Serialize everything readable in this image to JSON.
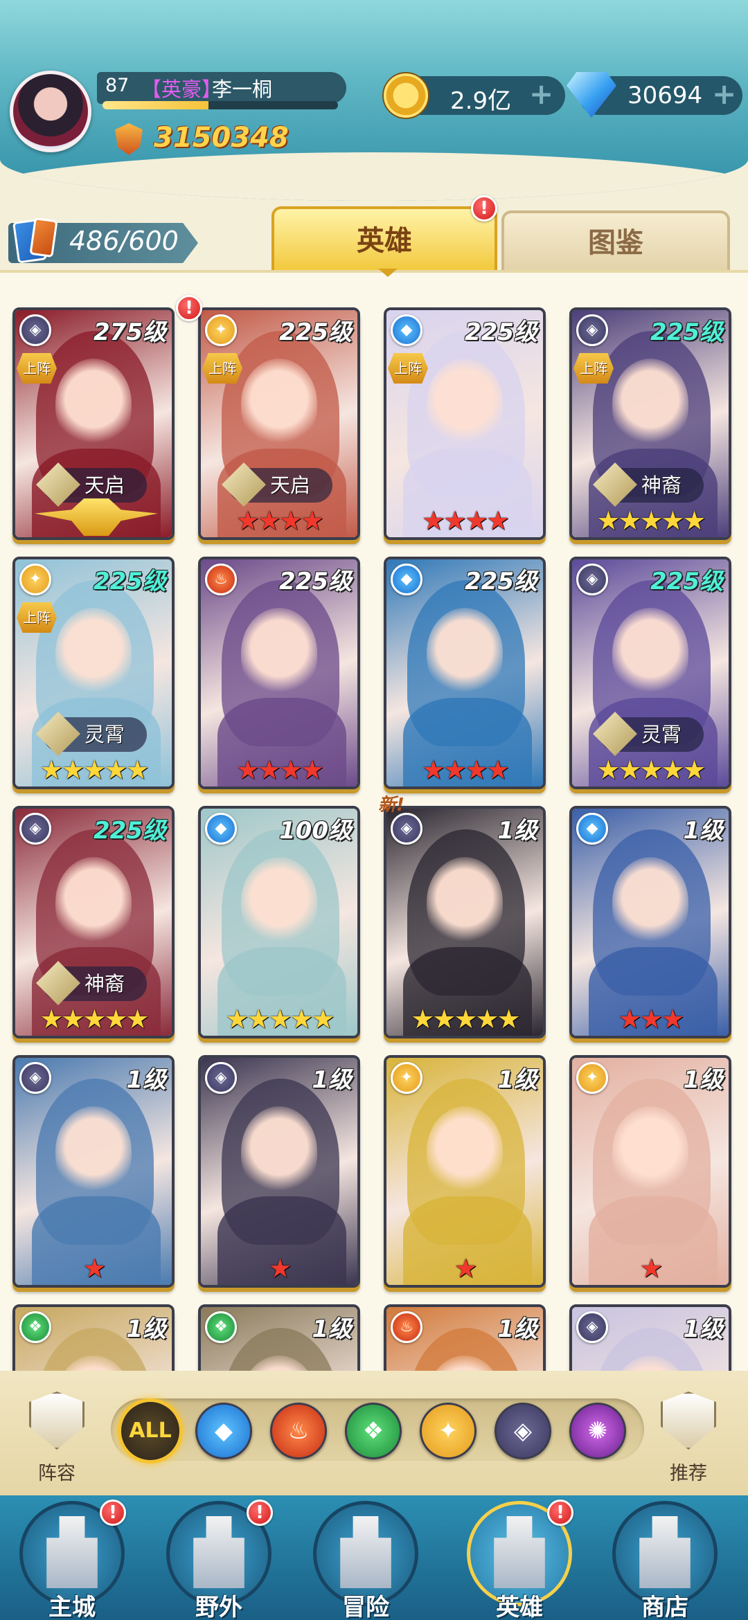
{
  "player": {
    "level": "87",
    "title": "【英豪】",
    "name": "李一桐",
    "exp_progress": 0.45,
    "power": "3150348"
  },
  "currency": {
    "gold": "2.9亿",
    "gems": "30694",
    "plus": "+"
  },
  "roster": {
    "count": "486/600",
    "tabs": [
      {
        "label": "英雄",
        "active": true,
        "alert": "!"
      },
      {
        "label": "图鉴",
        "active": false
      }
    ]
  },
  "heroes": [
    {
      "level": "275级",
      "element": "dark",
      "deployed": "上阵",
      "rank": "天启",
      "stars": "crown",
      "alert": "!",
      "color": "#8a1b28"
    },
    {
      "level": "225级",
      "element": "light",
      "deployed": "上阵",
      "rank": "天启",
      "stars": "★★★★",
      "star_color": "red",
      "color": "#c25a48"
    },
    {
      "level": "225级",
      "element": "water",
      "deployed": "上阵",
      "rank": "",
      "stars": "★★★★",
      "star_color": "red",
      "color": "#d8d3ef"
    },
    {
      "level": "225级",
      "element": "dark",
      "deployed": "上阵",
      "rank": "神裔",
      "stars": "★★★★★",
      "star_color": "gold",
      "level_cyan": true,
      "color": "#4b3e7a"
    },
    {
      "level": "225级",
      "element": "light",
      "deployed": "上阵",
      "rank": "灵霄",
      "stars": "★★★★★",
      "star_color": "gold",
      "level_cyan": true,
      "color": "#8fc2d8"
    },
    {
      "level": "225级",
      "element": "fire",
      "deployed": "",
      "rank": "",
      "stars": "★★★★",
      "star_color": "red",
      "color": "#6b4a8a"
    },
    {
      "level": "225级",
      "element": "water",
      "deployed": "",
      "rank": "",
      "stars": "★★★★",
      "star_color": "red",
      "color": "#2f78b8"
    },
    {
      "level": "225级",
      "element": "dark",
      "deployed": "",
      "rank": "灵霄",
      "stars": "★★★★★",
      "star_color": "gold",
      "level_cyan": true,
      "color": "#5b4a9a"
    },
    {
      "level": "225级",
      "element": "dark",
      "deployed": "",
      "rank": "神裔",
      "stars": "★★★★★",
      "star_color": "gold",
      "level_cyan": true,
      "color": "#8a2a3a"
    },
    {
      "level": "100级",
      "element": "water",
      "deployed": "",
      "rank": "",
      "stars": "★★★★★",
      "star_color": "gold",
      "color": "#9ec7c9"
    },
    {
      "level": "1级",
      "element": "dark",
      "deployed": "",
      "rank": "",
      "stars": "★★★★★",
      "star_color": "gold",
      "new": "新!",
      "color": "#2a2630"
    },
    {
      "level": "1级",
      "element": "water",
      "deployed": "",
      "rank": "",
      "stars": "★★★",
      "star_color": "red",
      "color": "#3a5fa8"
    },
    {
      "level": "1级",
      "element": "dark",
      "deployed": "",
      "rank": "",
      "stars": "★",
      "star_color": "red",
      "color": "#4a7ab0"
    },
    {
      "level": "1级",
      "element": "dark",
      "deployed": "",
      "rank": "",
      "stars": "★",
      "star_color": "red",
      "color": "#3b3550"
    },
    {
      "level": "1级",
      "element": "light",
      "deployed": "",
      "rank": "",
      "stars": "★",
      "star_color": "red",
      "color": "#d8b43a"
    },
    {
      "level": "1级",
      "element": "light",
      "deployed": "",
      "rank": "",
      "stars": "★",
      "star_color": "red",
      "color": "#e3b0a0"
    },
    {
      "level": "1级",
      "element": "nature",
      "deployed": "",
      "rank": "",
      "stars": "",
      "color": "#c7a860"
    },
    {
      "level": "1级",
      "element": "nature",
      "deployed": "",
      "rank": "",
      "stars": "",
      "color": "#8a7a5a"
    },
    {
      "level": "1级",
      "element": "fire",
      "deployed": "",
      "rank": "",
      "stars": "",
      "color": "#d27a3a"
    },
    {
      "level": "1级",
      "element": "dark",
      "deployed": "",
      "rank": "",
      "stars": "",
      "color": "#c8c3e0"
    }
  ],
  "filters": {
    "all_label": "ALL",
    "items": [
      "water-icon",
      "fire-icon",
      "nature-icon",
      "light-icon",
      "dark-icon",
      "void-icon"
    ],
    "lineup_label": "阵容",
    "recommend_label": "推荐"
  },
  "nav": [
    {
      "label": "主城",
      "alert": "!"
    },
    {
      "label": "野外",
      "alert": "!"
    },
    {
      "label": "冒险",
      "alert": ""
    },
    {
      "label": "英雄",
      "alert": "!",
      "active": true
    },
    {
      "label": "商店",
      "alert": ""
    }
  ]
}
